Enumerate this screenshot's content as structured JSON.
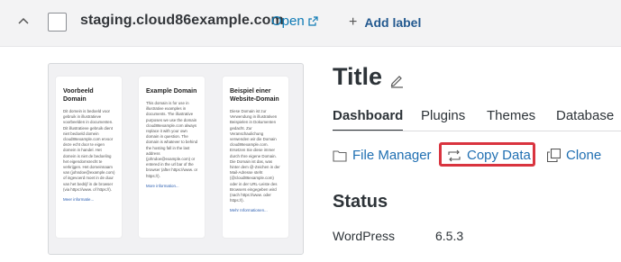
{
  "header": {
    "domain": "staging.cloud86example.com",
    "open_label": "Open",
    "add_label": "Add label"
  },
  "preview": {
    "columns": [
      {
        "heading": "Voorbeeld Domain",
        "body": "Dit domein is bedoeld voor gebruik in illustratieve voorbeelden in documenten. Dit illustratieve gebruik dient niet bedoeld domein cloud86example.com ervoor deze echt door te eigen domein in handel. Het domein is niet de bedoeling het eigendomsrecht te verkrijgen. Het domeinnaam van (johndoe@example.com) of ingevoerd moet in de duur van het bedrijf in de browser (via https://www. of https://).",
        "more": "Meer informatie..."
      },
      {
        "heading": "Example Domain",
        "body": "This domain is for use in illustrative examples in documents. The illustrative purposes we use the domain cloud86example.com always replace it with your own domain in question. The domain is whatever to behind the hosting fall in the last address (johndoe@example.com) or entered in the url bar of the browser (after https://www. or https://).",
        "more": "More information..."
      },
      {
        "heading": "Beispiel einer Website-Domain",
        "body": "Diese Domain ist zur Verwendung in illustrativen Beispielen in Dokumenten gedacht. Zur Veranschaulichung verwenden wir die Domain cloud86example.com. Ersetzen Sie diese immer durch Ihre eigene Domain. Die Domain ist das, was hinter dem @-Zeichen in der Mail-Adresse steht (@cloud86example.com) oder in der URL-Leiste des Browsers eingegeben wird (nach https://www. oder https://).",
        "more": "Mehr Informationen..."
      }
    ]
  },
  "site": {
    "title": "Title"
  },
  "tabs": [
    {
      "label": "Dashboard",
      "active": true
    },
    {
      "label": "Plugins",
      "active": false
    },
    {
      "label": "Themes",
      "active": false
    },
    {
      "label": "Database",
      "active": false
    }
  ],
  "actions": {
    "file_manager": "File Manager",
    "copy_data": "Copy Data",
    "clone": "Clone"
  },
  "status": {
    "heading": "Status",
    "wordpress_label": "WordPress",
    "wordpress_version": "6.5.3"
  },
  "colors": {
    "link": "#1f6fb2",
    "highlight": "#d9343f",
    "topbar_bg": "#f3f3f4"
  }
}
